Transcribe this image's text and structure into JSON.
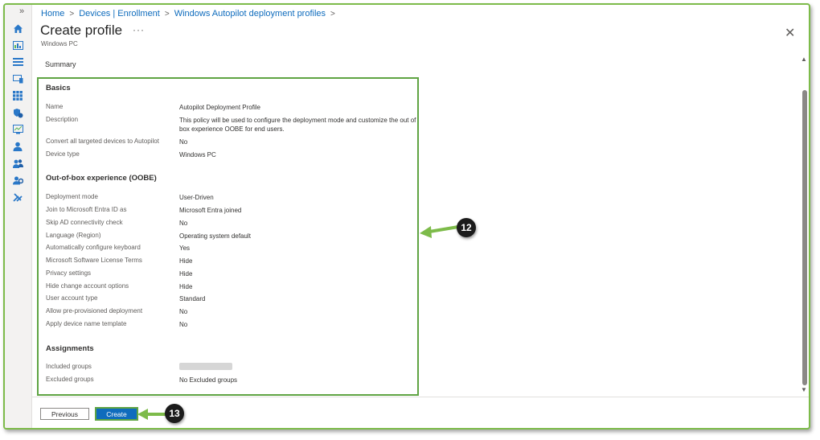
{
  "breadcrumb": {
    "items": [
      "Home",
      "Devices | Enrollment",
      "Windows Autopilot deployment profiles"
    ],
    "separator": ">"
  },
  "page": {
    "title": "Create profile",
    "more_label": "···",
    "subtitle": "Windows PC",
    "close_label": "✕"
  },
  "tabs": {
    "current": "Summary"
  },
  "basics": {
    "heading": "Basics",
    "rows": [
      {
        "label": "Name",
        "value": "Autopilot Deployment Profile"
      },
      {
        "label": "Description",
        "value": "This policy will be used to configure the deployment mode and customize the out of box experience OOBE for end users."
      },
      {
        "label": "Convert all targeted devices to Autopilot",
        "value": "No"
      },
      {
        "label": "Device type",
        "value": "Windows PC"
      }
    ]
  },
  "oobe": {
    "heading": "Out-of-box experience (OOBE)",
    "rows": [
      {
        "label": "Deployment mode",
        "value": "User-Driven"
      },
      {
        "label": "Join to Microsoft Entra ID as",
        "value": "Microsoft Entra joined"
      },
      {
        "label": "Skip AD connectivity check",
        "value": "No"
      },
      {
        "label": "Language (Region)",
        "value": "Operating system default"
      },
      {
        "label": "Automatically configure keyboard",
        "value": "Yes"
      },
      {
        "label": "Microsoft Software License Terms",
        "value": "Hide"
      },
      {
        "label": "Privacy settings",
        "value": "Hide"
      },
      {
        "label": "Hide change account options",
        "value": "Hide"
      },
      {
        "label": "User account type",
        "value": "Standard"
      },
      {
        "label": "Allow pre-provisioned deployment",
        "value": "No"
      },
      {
        "label": "Apply device name template",
        "value": "No"
      }
    ]
  },
  "assignments": {
    "heading": "Assignments",
    "rows": [
      {
        "label": "Included groups",
        "value": ""
      },
      {
        "label": "Excluded groups",
        "value": "No Excluded groups"
      }
    ]
  },
  "footer": {
    "previous_label": "Previous",
    "create_label": "Create"
  },
  "callouts": [
    "12",
    "13"
  ],
  "colors": {
    "accent": "#0f6cbd",
    "highlight_green": "#5fa443",
    "frame_green": "#7dbb4a",
    "callout_dark": "#1b1b1b"
  },
  "sidebar_icons": [
    "home-icon",
    "dashboard-icon",
    "all-services-icon",
    "devices-icon",
    "apps-icon",
    "endpoint-security-icon",
    "reports-icon",
    "users-icon",
    "groups-icon",
    "tenant-admin-icon",
    "troubleshooting-icon"
  ]
}
